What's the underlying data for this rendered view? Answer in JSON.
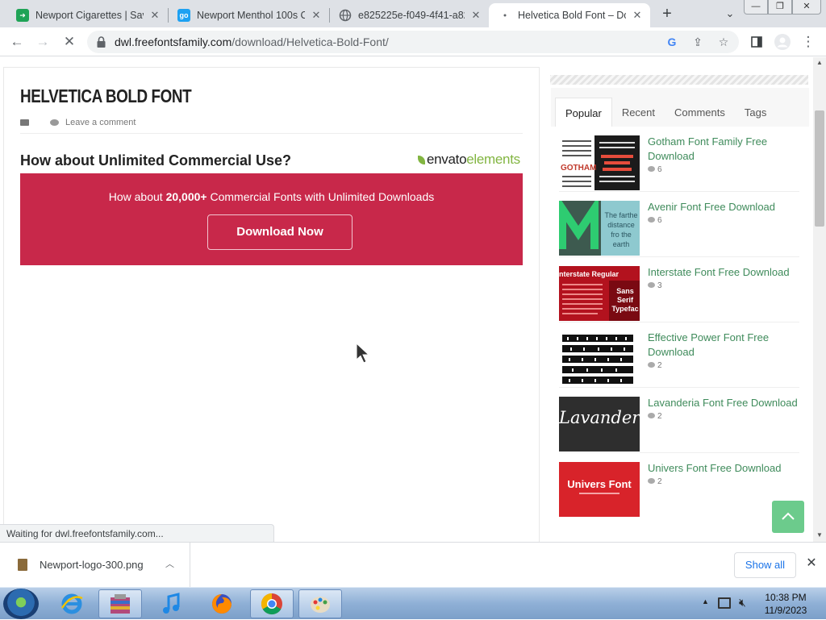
{
  "browser": {
    "tabs": [
      {
        "title": "Newport Cigarettes | Save",
        "favicon_color": "#1fa356",
        "active": false
      },
      {
        "title": "Newport Menthol 100s C",
        "favicon_color": "#1da1f2",
        "favicon_text": "go",
        "active": false
      },
      {
        "title": "e825225e-f049-4f41-a82",
        "favicon_color": "#5f6368",
        "active": false
      },
      {
        "title": "Helvetica Bold Font – Do",
        "favicon_color": "#5f6368",
        "active": true
      }
    ],
    "url": {
      "host": "dwl.freefontsfamily.com",
      "path": "/download/Helvetica-Bold-Font/"
    }
  },
  "article": {
    "title": "HELVETICA BOLD FONT",
    "comment_link": "Leave a comment",
    "promo_heading": "How about Unlimited Commercial Use?",
    "envato_brand": "envato",
    "envato_suffix": "elements",
    "banner_pre": "How about ",
    "banner_bold": "20,000+",
    "banner_post": " Commercial Fonts with Unlimited Downloads",
    "download_button": "Download Now",
    "banner_color": "#c8284a"
  },
  "sidebar": {
    "tabs": [
      "Popular",
      "Recent",
      "Comments",
      "Tags"
    ],
    "active_tab": "Popular",
    "link_color": "#3f8b5b",
    "items": [
      {
        "title": "Gotham Font Family Free Download",
        "comments": "6",
        "thumb": "gotham"
      },
      {
        "title": "Avenir Font Free Download",
        "comments": "6",
        "thumb": "avenir"
      },
      {
        "title": "Interstate Font Free Download",
        "comments": "3",
        "thumb": "interstate"
      },
      {
        "title": "Effective Power Font Free Download",
        "comments": "2",
        "thumb": "effective"
      },
      {
        "title": "Lavanderia Font Free Download",
        "comments": "2",
        "thumb": "lavanderia"
      },
      {
        "title": "Univers Font Free Download",
        "comments": "2",
        "thumb": "univers"
      }
    ],
    "thumb_text": {
      "avenir": "The farthe distance fro the earth",
      "interstate_head": "nterstate Regular",
      "interstate_side": "Sans Serif Typefac",
      "lavanderia": "Lavanderia",
      "univers": "Univers Font",
      "gotham": "GOTHAM"
    }
  },
  "status_bar": "Waiting for dwl.freefontsfamily.com...",
  "downloads": {
    "file": "Newport-logo-300.png",
    "show_all": "Show all"
  },
  "taskbar": {
    "time": "10:38 PM",
    "date": "11/9/2023"
  }
}
